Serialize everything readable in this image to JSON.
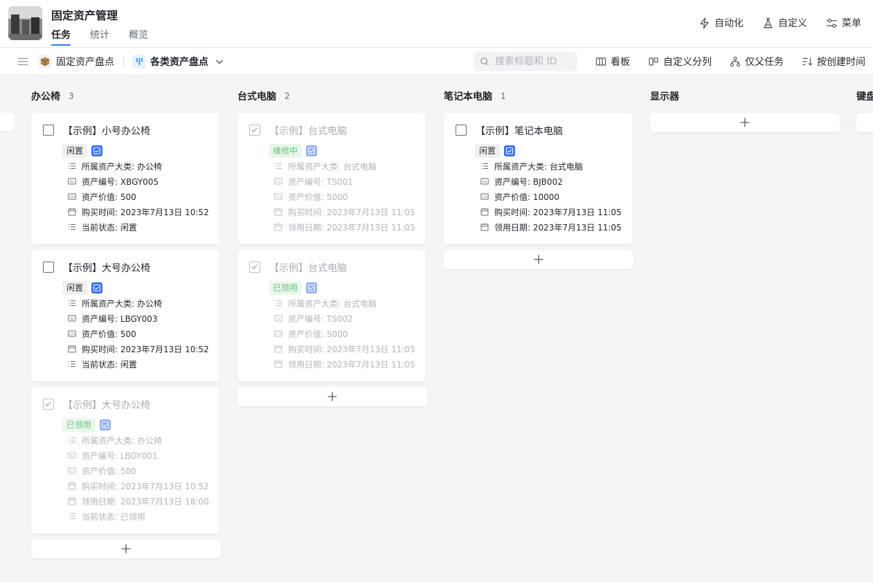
{
  "app": {
    "title": "固定资产管理"
  },
  "tabs": [
    {
      "label": "任务",
      "active": true
    },
    {
      "label": "统计",
      "active": false
    },
    {
      "label": "概览",
      "active": false
    }
  ],
  "header_actions": [
    {
      "label": "自动化",
      "icon": "lightning-icon"
    },
    {
      "label": "自定义",
      "icon": "flask-icon"
    },
    {
      "label": "菜单",
      "icon": "sliders-icon"
    }
  ],
  "toolbar": {
    "project": "固定资产盘点",
    "view": "各类资产盘点",
    "search_placeholder": "搜索标题和 ID",
    "actions": [
      {
        "label": "看板",
        "icon": "board-icon"
      },
      {
        "label": "自定义分列",
        "icon": "columns-icon"
      },
      {
        "label": "仅父任务",
        "icon": "hierarchy-icon"
      },
      {
        "label": "按创建时间",
        "icon": "sort-icon"
      }
    ]
  },
  "columns": [
    {
      "title": "办公椅",
      "count": "3",
      "cards": [
        {
          "title": "【示例】小号办公椅",
          "done": false,
          "status": "闲置",
          "fields": [
            "所属资产大类: 办公椅",
            "资产编号: XBGY005",
            "资产价值: 500",
            "购买时间: 2023年7月13日 10:52",
            "当前状态: 闲置"
          ]
        },
        {
          "title": "【示例】大号办公椅",
          "done": false,
          "status": "闲置",
          "fields": [
            "所属资产大类: 办公椅",
            "资产编号: LBGY003",
            "资产价值: 500",
            "购买时间: 2023年7月13日 10:52",
            "当前状态: 闲置"
          ]
        },
        {
          "title": "【示例】大号办公椅",
          "done": true,
          "status": "已领用",
          "fields": [
            "所属资产大类: 办公椅",
            "资产编号: LBGY001",
            "资产价值: 500",
            "购买时间: 2023年7月13日 10:52",
            "领用日期: 2023年7月13日 18:00",
            "当前状态: 已领用"
          ]
        }
      ]
    },
    {
      "title": "台式电脑",
      "count": "2",
      "cards": [
        {
          "title": "【示例】台式电脑",
          "done": true,
          "status": "维修中",
          "fields": [
            "所属资产大类: 台式电脑",
            "资产编号: TS001",
            "资产价值: 5000",
            "购买时间: 2023年7月13日 11:05",
            "领用日期: 2023年7月13日 11:05"
          ]
        },
        {
          "title": "【示例】台式电脑",
          "done": true,
          "status": "已领用",
          "fields": [
            "所属资产大类: 台式电脑",
            "资产编号: TS002",
            "资产价值: 5000",
            "购买时间: 2023年7月13日 11:05",
            "领用日期: 2023年7月13日 11:05"
          ]
        }
      ]
    },
    {
      "title": "笔记本电脑",
      "count": "1",
      "cards": [
        {
          "title": "【示例】笔记本电脑",
          "done": false,
          "status": "闲置",
          "fields": [
            "所属资产大类: 台式电脑",
            "资产编号: BJB002",
            "资产价值: 10000",
            "购买时间: 2023年7月13日 11:05",
            "领用日期: 2023年7月13日 11:05"
          ]
        }
      ]
    },
    {
      "title": "显示器",
      "count": "",
      "cards": []
    },
    {
      "title": "键盘",
      "count": "",
      "cards": []
    }
  ]
}
